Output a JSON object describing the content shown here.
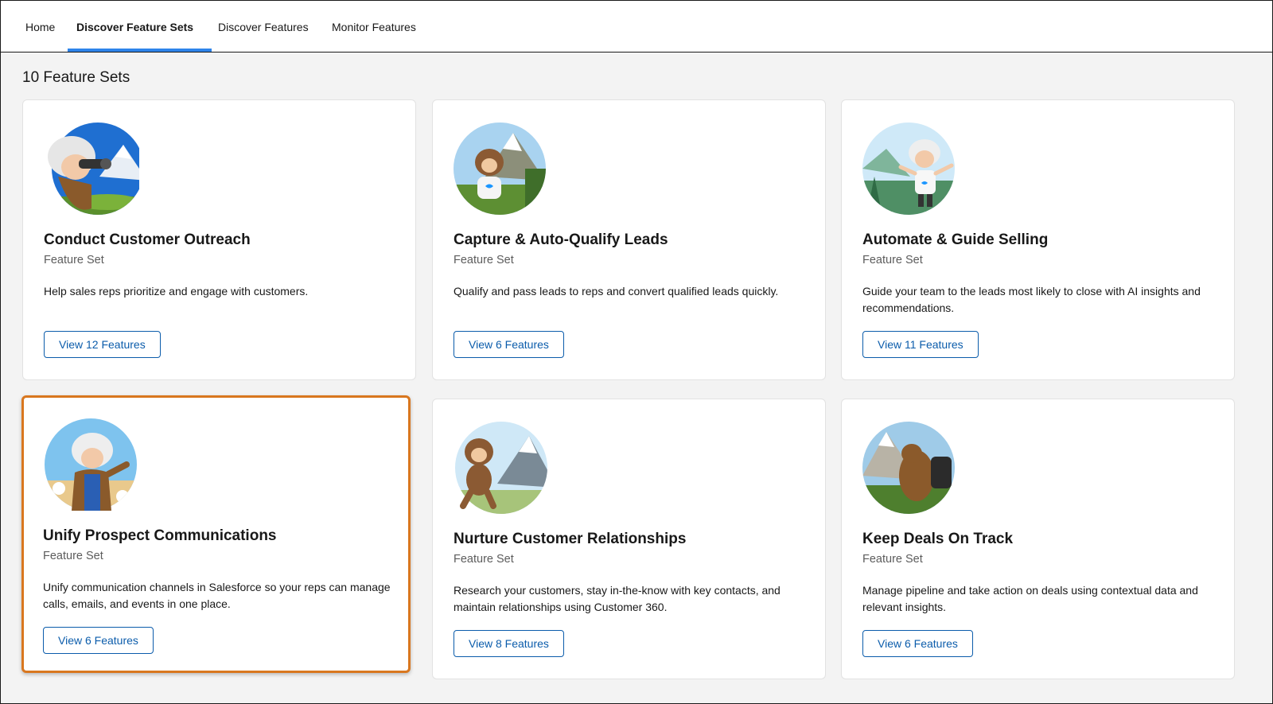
{
  "nav": {
    "tabs": [
      {
        "label": "Home"
      },
      {
        "label": "Discover Feature Sets"
      },
      {
        "label": "Discover Features"
      },
      {
        "label": "Monitor Features"
      }
    ],
    "active_tab": "Discover Feature Sets"
  },
  "main": {
    "count_title": "10 Feature Sets",
    "cards": [
      {
        "title": "Conduct Customer Outreach",
        "subtitle": "Feature Set",
        "description": "Help sales reps prioritize and engage with customers.",
        "button": "View 12 Features",
        "illustration": "einstein-binoculars-icon"
      },
      {
        "title": "Capture & Auto-Qualify Leads",
        "subtitle": "Feature Set",
        "description": "Qualify and pass leads to reps and convert qualified leads quickly.",
        "button": "View 6 Features",
        "illustration": "astro-sitting-icon"
      },
      {
        "title": "Automate & Guide Selling",
        "subtitle": "Feature Set",
        "description": "Guide your team to the leads most likely to close with AI insights and recommendations.",
        "button": "View 11 Features",
        "illustration": "einstein-waving-icon"
      },
      {
        "title": "Unify Prospect Communications",
        "subtitle": "Feature Set",
        "description": "Unify communication channels in Salesforce so your reps can manage calls, emails, and events in one place.",
        "button": "View 6 Features",
        "illustration": "einstein-flowers-icon",
        "highlighted": true
      },
      {
        "title": "Nurture Customer Relationships",
        "subtitle": "Feature Set",
        "description": "Research your customers, stay in-the-know with key contacts, and maintain relationships using Customer 360.",
        "button": "View 8 Features",
        "illustration": "astro-walking-icon"
      },
      {
        "title": "Keep Deals On Track",
        "subtitle": "Feature Set",
        "description": "Manage pipeline and take action on deals using contextual data and relevant insights.",
        "button": "View 6 Features",
        "illustration": "codey-backpack-icon"
      }
    ]
  },
  "colors": {
    "accent": "#2e84ea",
    "button_text": "#0b5cab",
    "highlight_border": "#d9771f",
    "background": "#f3f3f3"
  }
}
